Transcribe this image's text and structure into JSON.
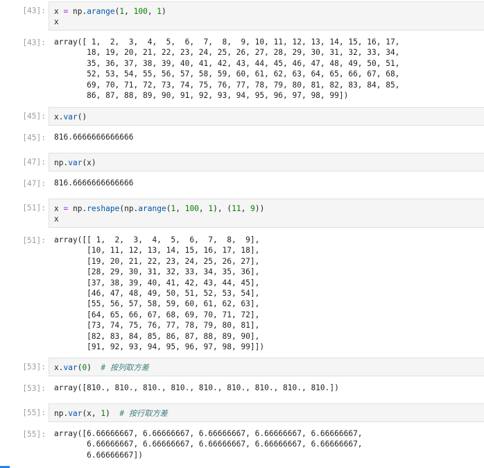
{
  "cells": [
    {
      "in_prompt": "[43]:",
      "code_lines": [
        [
          {
            "t": "x "
          },
          {
            "t": "=",
            "c": "kw-op"
          },
          {
            "t": " np."
          },
          {
            "t": "arange",
            "c": "attr"
          },
          {
            "t": "("
          },
          {
            "t": "1",
            "c": "num"
          },
          {
            "t": ", "
          },
          {
            "t": "100",
            "c": "num"
          },
          {
            "t": ", "
          },
          {
            "t": "1",
            "c": "num"
          },
          {
            "t": ")"
          }
        ],
        [
          {
            "t": "x"
          }
        ]
      ],
      "out_prompt": "[43]:",
      "output": "array([ 1,  2,  3,  4,  5,  6,  7,  8,  9, 10, 11, 12, 13, 14, 15, 16, 17,\n       18, 19, 20, 21, 22, 23, 24, 25, 26, 27, 28, 29, 30, 31, 32, 33, 34,\n       35, 36, 37, 38, 39, 40, 41, 42, 43, 44, 45, 46, 47, 48, 49, 50, 51,\n       52, 53, 54, 55, 56, 57, 58, 59, 60, 61, 62, 63, 64, 65, 66, 67, 68,\n       69, 70, 71, 72, 73, 74, 75, 76, 77, 78, 79, 80, 81, 82, 83, 84, 85,\n       86, 87, 88, 89, 90, 91, 92, 93, 94, 95, 96, 97, 98, 99])"
    },
    {
      "in_prompt": "[45]:",
      "code_lines": [
        [
          {
            "t": "x."
          },
          {
            "t": "var",
            "c": "attr"
          },
          {
            "t": "()"
          }
        ]
      ],
      "out_prompt": "[45]:",
      "output": "816.6666666666666"
    },
    {
      "in_prompt": "[47]:",
      "code_lines": [
        [
          {
            "t": "np."
          },
          {
            "t": "var",
            "c": "attr"
          },
          {
            "t": "(x)"
          }
        ]
      ],
      "out_prompt": "[47]:",
      "output": "816.6666666666666"
    },
    {
      "in_prompt": "[51]:",
      "code_lines": [
        [
          {
            "t": "x "
          },
          {
            "t": "=",
            "c": "kw-op"
          },
          {
            "t": " np."
          },
          {
            "t": "reshape",
            "c": "attr"
          },
          {
            "t": "(np."
          },
          {
            "t": "arange",
            "c": "attr"
          },
          {
            "t": "("
          },
          {
            "t": "1",
            "c": "num"
          },
          {
            "t": ", "
          },
          {
            "t": "100",
            "c": "num"
          },
          {
            "t": ", "
          },
          {
            "t": "1",
            "c": "num"
          },
          {
            "t": "), ("
          },
          {
            "t": "11",
            "c": "num"
          },
          {
            "t": ", "
          },
          {
            "t": "9",
            "c": "num"
          },
          {
            "t": "))"
          }
        ],
        [
          {
            "t": "x"
          }
        ]
      ],
      "out_prompt": "[51]:",
      "output": "array([[ 1,  2,  3,  4,  5,  6,  7,  8,  9],\n       [10, 11, 12, 13, 14, 15, 16, 17, 18],\n       [19, 20, 21, 22, 23, 24, 25, 26, 27],\n       [28, 29, 30, 31, 32, 33, 34, 35, 36],\n       [37, 38, 39, 40, 41, 42, 43, 44, 45],\n       [46, 47, 48, 49, 50, 51, 52, 53, 54],\n       [55, 56, 57, 58, 59, 60, 61, 62, 63],\n       [64, 65, 66, 67, 68, 69, 70, 71, 72],\n       [73, 74, 75, 76, 77, 78, 79, 80, 81],\n       [82, 83, 84, 85, 86, 87, 88, 89, 90],\n       [91, 92, 93, 94, 95, 96, 97, 98, 99]])"
    },
    {
      "in_prompt": "[53]:",
      "code_lines": [
        [
          {
            "t": "x."
          },
          {
            "t": "var",
            "c": "attr"
          },
          {
            "t": "("
          },
          {
            "t": "0",
            "c": "num"
          },
          {
            "t": ")  "
          },
          {
            "t": "# 按列取方差",
            "c": "comment"
          }
        ]
      ],
      "out_prompt": "[53]:",
      "output": "array([810., 810., 810., 810., 810., 810., 810., 810., 810.])"
    },
    {
      "in_prompt": "[55]:",
      "code_lines": [
        [
          {
            "t": "np."
          },
          {
            "t": "var",
            "c": "attr"
          },
          {
            "t": "(x, "
          },
          {
            "t": "1",
            "c": "num"
          },
          {
            "t": ")  "
          },
          {
            "t": "# 按行取方差",
            "c": "comment"
          }
        ]
      ],
      "out_prompt": "[55]:",
      "output": "array([6.66666667, 6.66666667, 6.66666667, 6.66666667, 6.66666667,\n       6.66666667, 6.66666667, 6.66666667, 6.66666667, 6.66666667,\n       6.66666667])"
    }
  ]
}
